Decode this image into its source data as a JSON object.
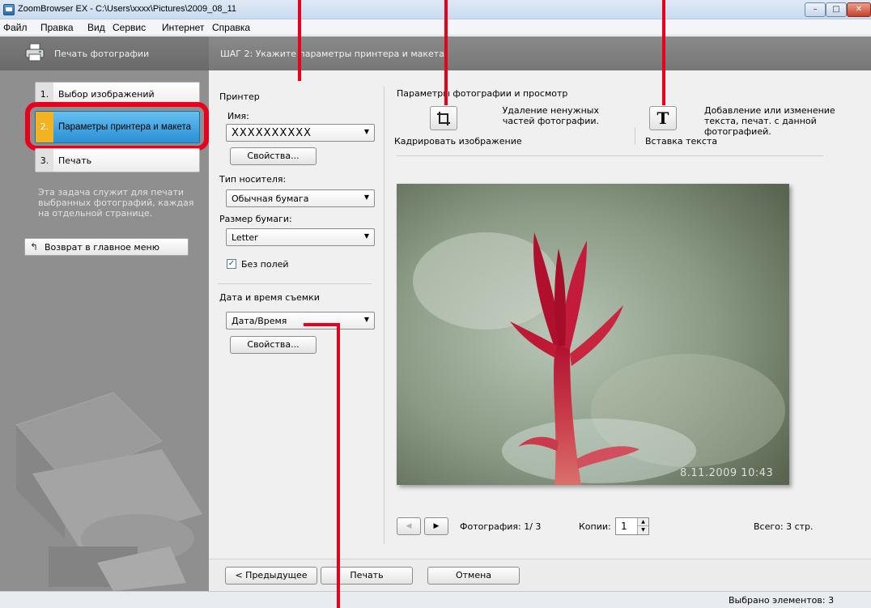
{
  "window": {
    "title": "ZoomBrowser EX - C:\\Users\\xxxx\\Pictures\\2009_08_11",
    "min": "–",
    "max": "□",
    "close": "✕"
  },
  "menu": [
    "Файл",
    "Правка",
    "Вид",
    "Сервис",
    "Интернет",
    "Справка"
  ],
  "left": {
    "header": "Печать фотографии",
    "steps": [
      {
        "num": "1.",
        "label": "Выбор изображений"
      },
      {
        "num": "2.",
        "label": "Параметры принтера и макета"
      },
      {
        "num": "3.",
        "label": "Печать"
      }
    ],
    "description": "Эта задача служит для печати выбранных фотографий, каждая на отдельной странице.",
    "back_button": "Возврат в главное меню",
    "back_icon": "↰"
  },
  "step_header": "ШАГ 2: Укажите параметры принтера и макета",
  "printer": {
    "section": "Принтер",
    "name_label": "Имя:",
    "name_value": "XXXXXXXXXX",
    "properties_button": "Свойства...",
    "media_label": "Тип носителя:",
    "media_value": "Обычная бумага",
    "paper_label": "Размер бумаги:",
    "paper_value": "Letter",
    "borderless_label": "Без полей",
    "borderless_checked": true,
    "date_section": "Дата и время съемки",
    "date_value": "Дата/Время",
    "date_properties_button": "Свойства..."
  },
  "photo_params": {
    "section": "Параметры фотографии и просмотр",
    "crop_desc": "Удаление ненужных частей фотографии.",
    "crop_label": "Кадрировать изображение",
    "text_desc": "Добавление или изменение текста, печат. с данной фотографией.",
    "text_label": "Вставка текста",
    "text_icon": "T"
  },
  "preview": {
    "date_stamp": "8.11.2009   10:43",
    "photo_counter": "Фотография: 1/ 3",
    "copies_label": "Копии:",
    "copies_value": "1",
    "total": "Всего: 3 стр.",
    "prev_glyph": "◀",
    "next_glyph": "▶"
  },
  "bottom": {
    "prev_button": "< Предыдущее",
    "print_button": "Печать",
    "cancel_button": "Отмена"
  },
  "status": "Выбрано элементов: 3",
  "colors": {
    "highlight": "#e8001c",
    "step_active": "#2a8fd4",
    "step_num_active": "#f2b323"
  }
}
